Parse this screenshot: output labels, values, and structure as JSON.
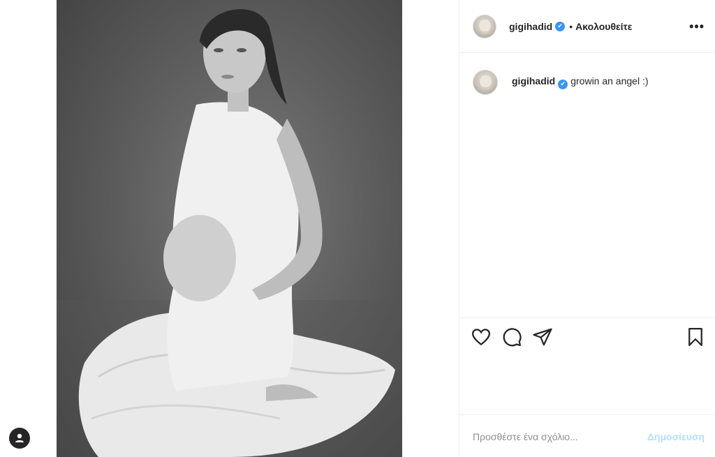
{
  "post": {
    "username": "gigihadid",
    "verified_mark": "✔",
    "separator": "•",
    "follow_state": "Ακολουθείτε",
    "more_label": "•••",
    "caption": {
      "username": "gigihadid",
      "text": "growin an angel :)"
    },
    "image_description": "black-and-white portrait photo"
  },
  "actions": {
    "like_icon": "heart-icon",
    "comment_icon": "comment-bubble-icon",
    "share_icon": "paper-plane-icon",
    "save_icon": "bookmark-icon"
  },
  "comment_box": {
    "placeholder": "Προσθέστε ένα σχόλιο...",
    "post_label": "Δημοσίευση",
    "post_color": "#b2dffc"
  },
  "colors": {
    "verified_blue": "#3897f0",
    "text": "#262626",
    "divider": "#efefef"
  }
}
